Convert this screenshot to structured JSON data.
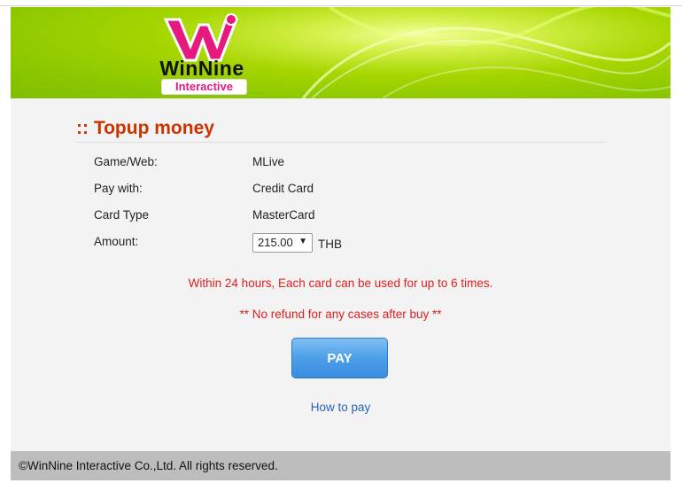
{
  "brand": {
    "name": "WinNine",
    "sub": "Interactive",
    "colors": {
      "banner_green": "#8cc800",
      "logo_pink": "#e6197f",
      "heading": "#cc3300",
      "notice": "#e01e1e",
      "link": "#2a63b5",
      "button": "#4d9fe9",
      "footer": "#bdbdbd"
    }
  },
  "page": {
    "title": ":: Topup money"
  },
  "form": {
    "rows": [
      {
        "label": "Game/Web:",
        "value": "MLive"
      },
      {
        "label": "Pay with:",
        "value": "Credit Card"
      },
      {
        "label": "Card Type",
        "value": "MasterCard"
      }
    ],
    "amount": {
      "label": "Amount:",
      "selected": "215.00",
      "currency": "THB"
    }
  },
  "notices": {
    "limit": "Within 24 hours, Each card can be used for up to 6 times.",
    "refund": "** No refund for any cases after buy **"
  },
  "actions": {
    "pay_label": "PAY",
    "how_to_pay": "How to pay"
  },
  "footer": {
    "text": "©WinNine Interactive Co.,Ltd. All rights reserved."
  },
  "icons": {
    "select_arrow": "chevron-down-icon"
  }
}
